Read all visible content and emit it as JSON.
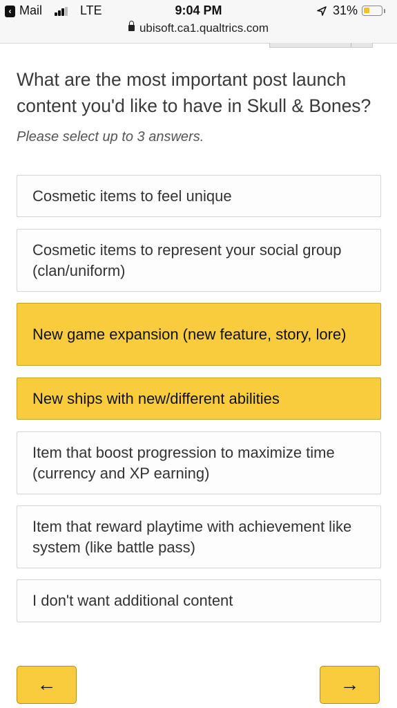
{
  "status_bar": {
    "back_app": "Mail",
    "network": "LTE",
    "time": "9:04 PM",
    "battery_percent": "31%",
    "battery_level": 0.31,
    "battery_color": "#f2c31a",
    "signal_bars_active": 3,
    "url": "ubisoft.ca1.qualtrics.com"
  },
  "survey": {
    "question": "What are the most important post launch content you'd like to have in Skull & Bones?",
    "instruction": "Please select up to 3 answers.",
    "choices": [
      {
        "label": "Cosmetic items to feel unique",
        "selected": false
      },
      {
        "label": "Cosmetic items to represent your social group (clan/uniform)",
        "selected": false
      },
      {
        "label": "New game expansion (new feature, story, lore)",
        "selected": true
      },
      {
        "label": "New ships with new/different abilities",
        "selected": true
      },
      {
        "label": "Item that boost progression to maximize time (currency and XP earning)",
        "selected": false
      },
      {
        "label": "Item that reward playtime with achievement like system (like battle pass)",
        "selected": false
      },
      {
        "label": "I don't want additional content",
        "selected": false
      }
    ],
    "accent_color": "#f9cc3e"
  },
  "navigation": {
    "back_label": "←",
    "next_label": "→"
  }
}
